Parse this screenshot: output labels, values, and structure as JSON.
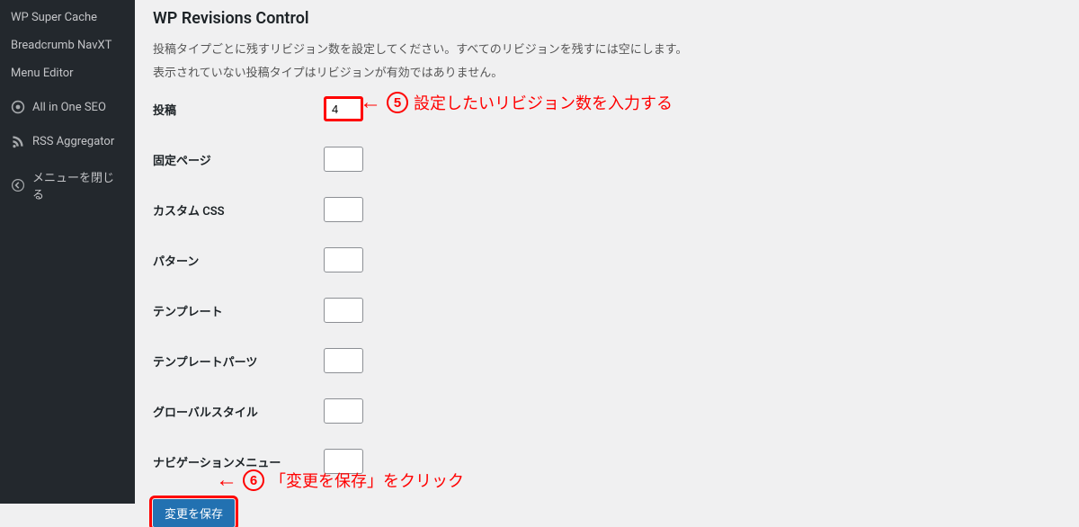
{
  "sidebar": {
    "items": [
      {
        "label": "WP Super Cache",
        "icon": null
      },
      {
        "label": "Breadcrumb NavXT",
        "icon": null
      },
      {
        "label": "Menu Editor",
        "icon": null
      },
      {
        "label": "All in One SEO",
        "icon": "aioseo"
      },
      {
        "label": "RSS Aggregator",
        "icon": "rss"
      },
      {
        "label": "メニューを閉じる",
        "icon": "collapse"
      }
    ]
  },
  "main": {
    "section_title": "WP Revisions Control",
    "desc1": "投稿タイプごとに残すリビジョン数を設定してください。すべてのリビジョンを残すには空にします。",
    "desc2": "表示されていない投稿タイプはリビジョンが有効ではありません。",
    "fields": [
      {
        "label": "投稿",
        "value": "4",
        "highlight": true
      },
      {
        "label": "固定ページ",
        "value": ""
      },
      {
        "label": "カスタム CSS",
        "value": ""
      },
      {
        "label": "パターン",
        "value": ""
      },
      {
        "label": "テンプレート",
        "value": ""
      },
      {
        "label": "テンプレートパーツ",
        "value": ""
      },
      {
        "label": "グローバルスタイル",
        "value": ""
      },
      {
        "label": "ナビゲーションメニュー",
        "value": ""
      }
    ],
    "submit_label": "変更を保存"
  },
  "annotations": {
    "a5": {
      "num": "5",
      "text": "設定したいリビジョン数を入力する"
    },
    "a6": {
      "num": "6",
      "text": "「変更を保存」をクリック"
    }
  }
}
